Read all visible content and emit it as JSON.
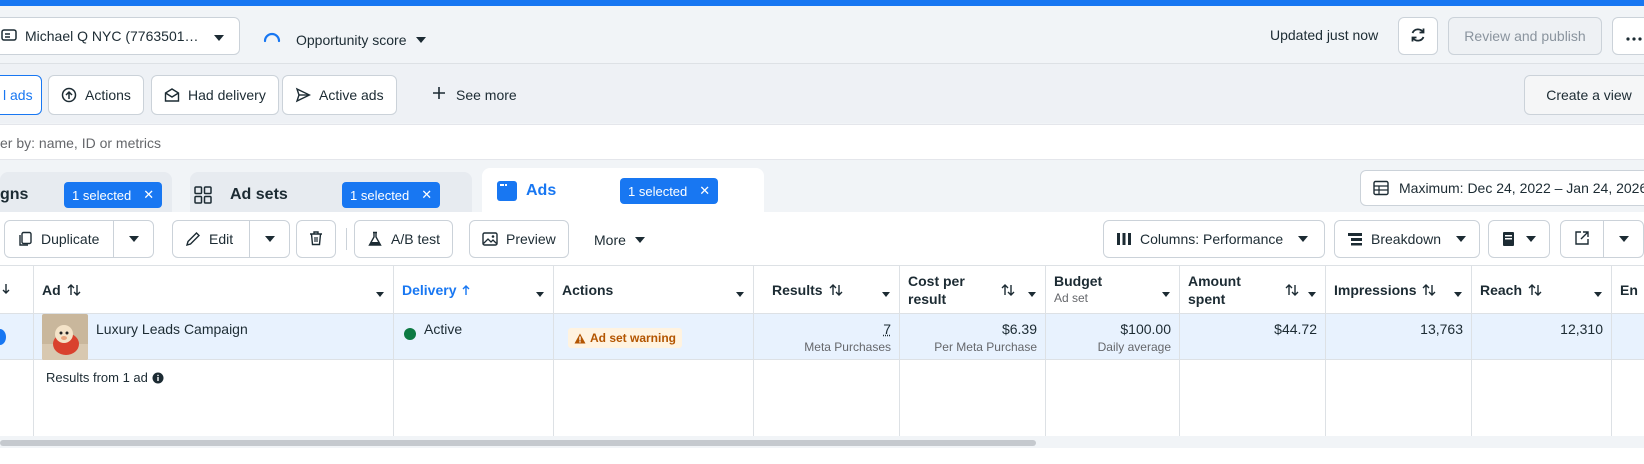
{
  "header": {
    "account_name": "Michael Q NYC (7763501…",
    "opportunity_label": "Opportunity score",
    "updated_text": "Updated just now",
    "review_publish_label": "Review and publish"
  },
  "filters": {
    "chips": [
      "l ads",
      "Actions",
      "Had delivery",
      "Active ads"
    ],
    "see_more_label": "See more",
    "create_view_label": "Create a view",
    "search_placeholder": "er by: name, ID or metrics"
  },
  "levels": {
    "campaigns": {
      "name": "gns",
      "selected": "1 selected"
    },
    "adsets": {
      "name": "Ad sets",
      "selected": "1 selected"
    },
    "ads": {
      "name": "Ads",
      "selected": "1 selected"
    },
    "date_range": "Maximum: Dec 24, 2022 – Jan 24, 2026"
  },
  "toolbar": {
    "duplicate_label": "Duplicate",
    "edit_label": "Edit",
    "ab_test_label": "A/B test",
    "preview_label": "Preview",
    "more_label": "More",
    "columns_label": "Columns: Performance",
    "breakdown_label": "Breakdown"
  },
  "table": {
    "headers": {
      "ad": "Ad",
      "delivery": "Delivery",
      "actions": "Actions",
      "results": "Results",
      "cost_per_result": "Cost per result",
      "budget": "Budget",
      "budget_sub": "Ad set",
      "amount_spent": "Amount spent",
      "impressions": "Impressions",
      "reach": "Reach",
      "ends": "En"
    },
    "row": {
      "ad_name": "Luxury Leads Campaign",
      "delivery": "Active",
      "actions_warning": "Ad set warning",
      "results": "7",
      "results_sub": "Meta Purchases",
      "cost_per_result": "$6.39",
      "cost_per_result_sub": "Per Meta Purchase",
      "budget": "$100.00",
      "budget_sub": "Daily average",
      "amount_spent": "$44.72",
      "impressions": "13,763",
      "reach": "12,310"
    },
    "summary_label": "Results from 1 ad"
  },
  "colors": {
    "accent": "#1877f2",
    "active_dot": "#0c7a43",
    "warning": "#b35500"
  }
}
